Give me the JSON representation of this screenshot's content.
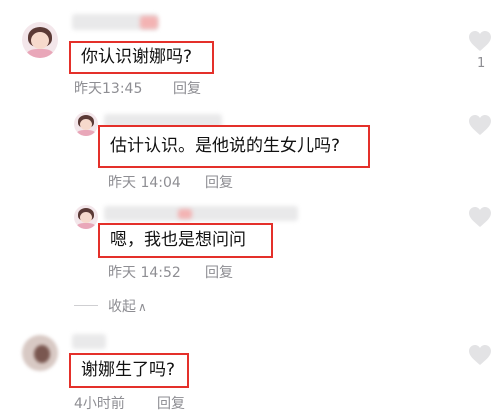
{
  "comments": [
    {
      "text": "你认识谢娜吗?",
      "time": "昨天13:45",
      "reply": "回复",
      "likes": "1"
    },
    {
      "text": "估计认识。是他说的生女儿吗?",
      "time": "昨天 14:04",
      "reply": "回复"
    },
    {
      "text": "嗯，我也是想问问",
      "time": "昨天 14:52",
      "reply": "回复"
    },
    {
      "text": "谢娜生了吗?",
      "time": "4小时前",
      "reply": "回复"
    }
  ],
  "collapse": {
    "label": "收起",
    "icon": "chevron-up-icon"
  },
  "icons": {
    "like": "heart-outline-icon"
  },
  "colors": {
    "highlight_box": "#e4302a",
    "meta_text": "#8e8e93",
    "heart_fill": "#e3e3e5"
  }
}
